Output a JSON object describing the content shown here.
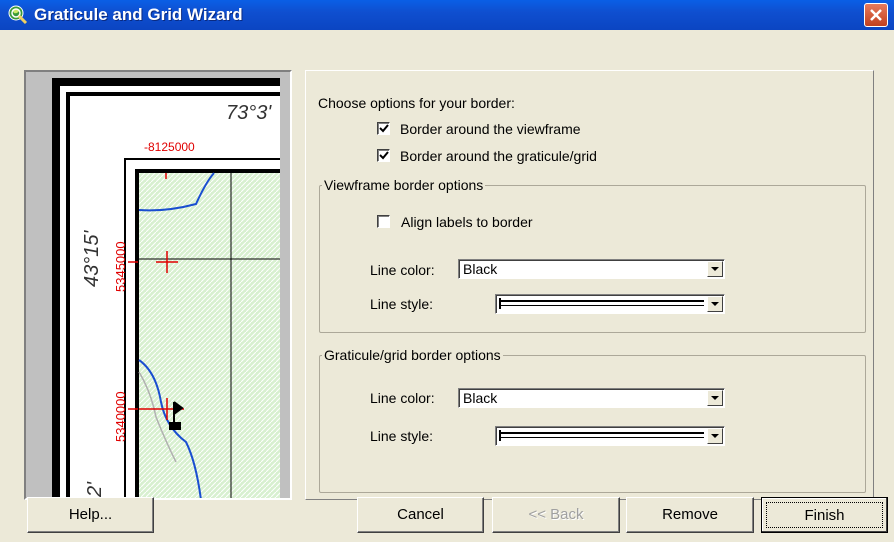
{
  "window": {
    "title": "Graticule and Grid Wizard"
  },
  "preview": {
    "top_label": "73°3'",
    "x_label": "-8125000",
    "lat_label": "43°15'",
    "y_label_1": "5345000",
    "y_label_2": "5340000",
    "corner_label": "2'"
  },
  "options": {
    "heading": "Choose options for your border:",
    "border_viewframe": {
      "label": "Border around the viewframe",
      "checked": true
    },
    "border_graticule": {
      "label": "Border around the graticule/grid",
      "checked": true
    },
    "viewframe_group": {
      "title": "Viewframe border options",
      "align_labels": {
        "label": "Align labels to border",
        "checked": false
      },
      "line_color_label": "Line color:",
      "line_color_value": "Black",
      "line_style_label": "Line style:"
    },
    "graticule_group": {
      "title": "Graticule/grid border options",
      "line_color_label": "Line color:",
      "line_color_value": "Black",
      "line_style_label": "Line style:"
    }
  },
  "buttons": {
    "help": "Help...",
    "cancel": "Cancel",
    "back": "<< Back",
    "remove": "Remove",
    "finish": "Finish"
  }
}
